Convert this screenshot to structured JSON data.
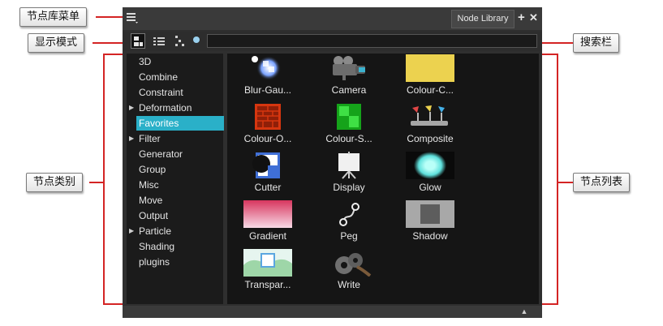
{
  "callouts": {
    "node_library_menu": "节点库菜单",
    "display_mode": "显示模式",
    "search_bar": "搜索栏",
    "node_categories": "节点类别",
    "node_list": "节点列表"
  },
  "panel": {
    "tab_title": "Node Library",
    "menu_icon": "hamburger-menu-icon",
    "add_icon": "plus-icon",
    "close_icon": "close-icon",
    "search": {
      "value": "",
      "placeholder": ""
    }
  },
  "categories": [
    {
      "label": "3D",
      "expandable": false,
      "selected": false
    },
    {
      "label": "Combine",
      "expandable": false,
      "selected": false
    },
    {
      "label": "Constraint",
      "expandable": false,
      "selected": false
    },
    {
      "label": "Deformation",
      "expandable": true,
      "selected": false
    },
    {
      "label": "Favorites",
      "expandable": false,
      "selected": true
    },
    {
      "label": "Filter",
      "expandable": true,
      "selected": false
    },
    {
      "label": "Generator",
      "expandable": false,
      "selected": false
    },
    {
      "label": "Group",
      "expandable": false,
      "selected": false
    },
    {
      "label": "Misc",
      "expandable": false,
      "selected": false
    },
    {
      "label": "Move",
      "expandable": false,
      "selected": false
    },
    {
      "label": "Output",
      "expandable": false,
      "selected": false
    },
    {
      "label": "Particle",
      "expandable": true,
      "selected": false
    },
    {
      "label": "Shading",
      "expandable": false,
      "selected": false
    },
    {
      "label": "plugins",
      "expandable": false,
      "selected": false
    }
  ],
  "nodes": [
    {
      "label": "Blur-Gau...",
      "icon": "blur-gaussian-icon"
    },
    {
      "label": "Camera",
      "icon": "camera-icon"
    },
    {
      "label": "Colour-C...",
      "icon": "colour-card-icon"
    },
    {
      "label": "Colour-O...",
      "icon": "colour-override-icon"
    },
    {
      "label": "Colour-S...",
      "icon": "colour-screen-icon"
    },
    {
      "label": "Composite",
      "icon": "composite-icon"
    },
    {
      "label": "Cutter",
      "icon": "cutter-icon"
    },
    {
      "label": "Display",
      "icon": "display-icon"
    },
    {
      "label": "Glow",
      "icon": "glow-icon"
    },
    {
      "label": "Gradient",
      "icon": "gradient-icon"
    },
    {
      "label": "Peg",
      "icon": "peg-icon"
    },
    {
      "label": "Shadow",
      "icon": "shadow-icon"
    },
    {
      "label": "Transpar...",
      "icon": "transparency-icon"
    },
    {
      "label": "Write",
      "icon": "write-icon"
    }
  ],
  "colors": {
    "callout_line": "#d42424",
    "selection": "#2ab0c8",
    "panel_bg": "#2f2f2f"
  }
}
